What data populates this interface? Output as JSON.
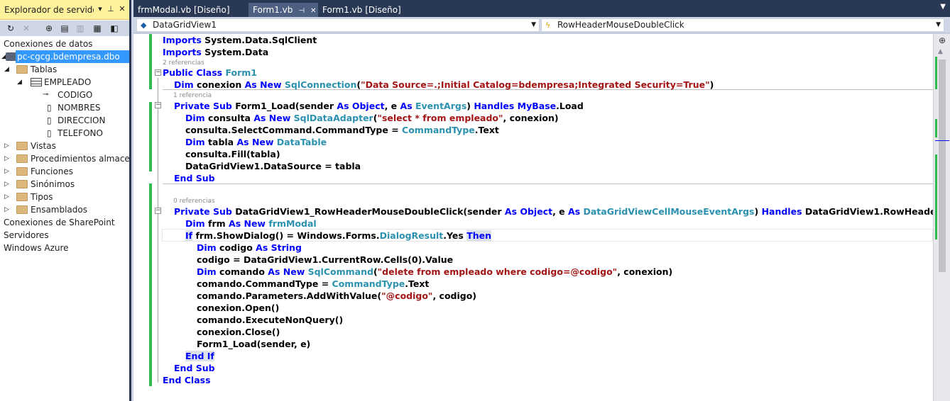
{
  "server_explorer": {
    "title": "Explorador de servidores",
    "tree": {
      "data_connections": "Conexiones de datos",
      "connection": "pc-cgcg.bdempresa.dbo",
      "tables": "Tablas",
      "table": "EMPLEADO",
      "columns": [
        "CODIGO",
        "NOMBRES",
        "DIRECCION",
        "TELEFONO"
      ],
      "views": "Vistas",
      "procedures": "Procedimientos almacenados",
      "functions": "Funciones",
      "synonyms": "Sinónimos",
      "types": "Tipos",
      "assemblies": "Ensamblados",
      "sharepoint": "Conexiones de SharePoint",
      "servers": "Servidores",
      "azure": "Windows Azure"
    }
  },
  "tabs": [
    {
      "label": "frmModal.vb [Diseño]"
    },
    {
      "label": "Form1.vb",
      "active": true
    },
    {
      "label": "Form1.vb [Diseño]"
    }
  ],
  "navbar": {
    "object": "DataGridView1",
    "member": "RowHeaderMouseDoubleClick"
  },
  "code": {
    "refs": {
      "class_refs": "2 referencias",
      "load_refs": "1 referencia",
      "dbl_refs": "0 referencias"
    }
  }
}
